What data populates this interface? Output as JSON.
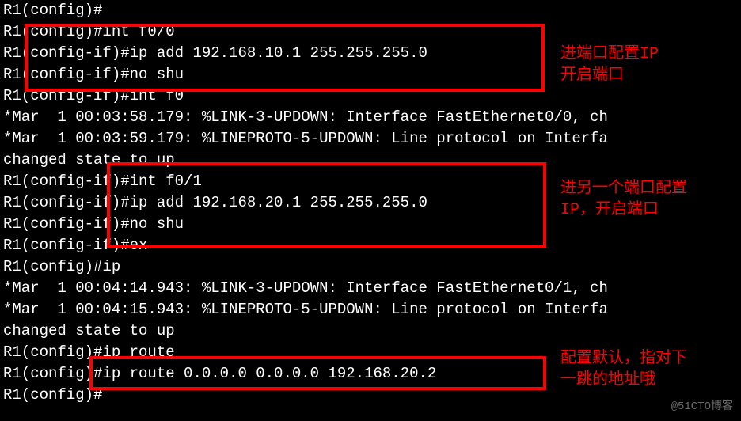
{
  "lines": [
    "R1(config)#",
    "R1(config)#int f0/0",
    "R1(config-if)#ip add 192.168.10.1 255.255.255.0",
    "R1(config-if)#no shu",
    "R1(config-if)#int f0",
    "*Mar  1 00:03:58.179: %LINK-3-UPDOWN: Interface FastEthernet0/0, ch",
    "*Mar  1 00:03:59.179: %LINEPROTO-5-UPDOWN: Line protocol on Interfa",
    "changed state to up",
    "R1(config-if)#int f0/1",
    "R1(config-if)#ip add 192.168.20.1 255.255.255.0",
    "R1(config-if)#no shu",
    "R1(config-if)#ex",
    "R1(config)#ip",
    "*Mar  1 00:04:14.943: %LINK-3-UPDOWN: Interface FastEthernet0/1, ch",
    "*Mar  1 00:04:15.943: %LINEPROTO-5-UPDOWN: Line protocol on Interfa",
    "changed state to up",
    "R1(config)#ip route",
    "R1(config)#ip route 0.0.0.0 0.0.0.0 192.168.20.2",
    "R1(config)#"
  ],
  "annotations": {
    "a1_l1": "进端口配置IP",
    "a1_l2": "开启端口",
    "a2_l1": "进另一个端口配置",
    "a2_l2": "IP，开启端口",
    "a3_l1": "配置默认，指对下",
    "a3_l2": "一跳的地址哦"
  },
  "watermark": "@51CTO博客"
}
